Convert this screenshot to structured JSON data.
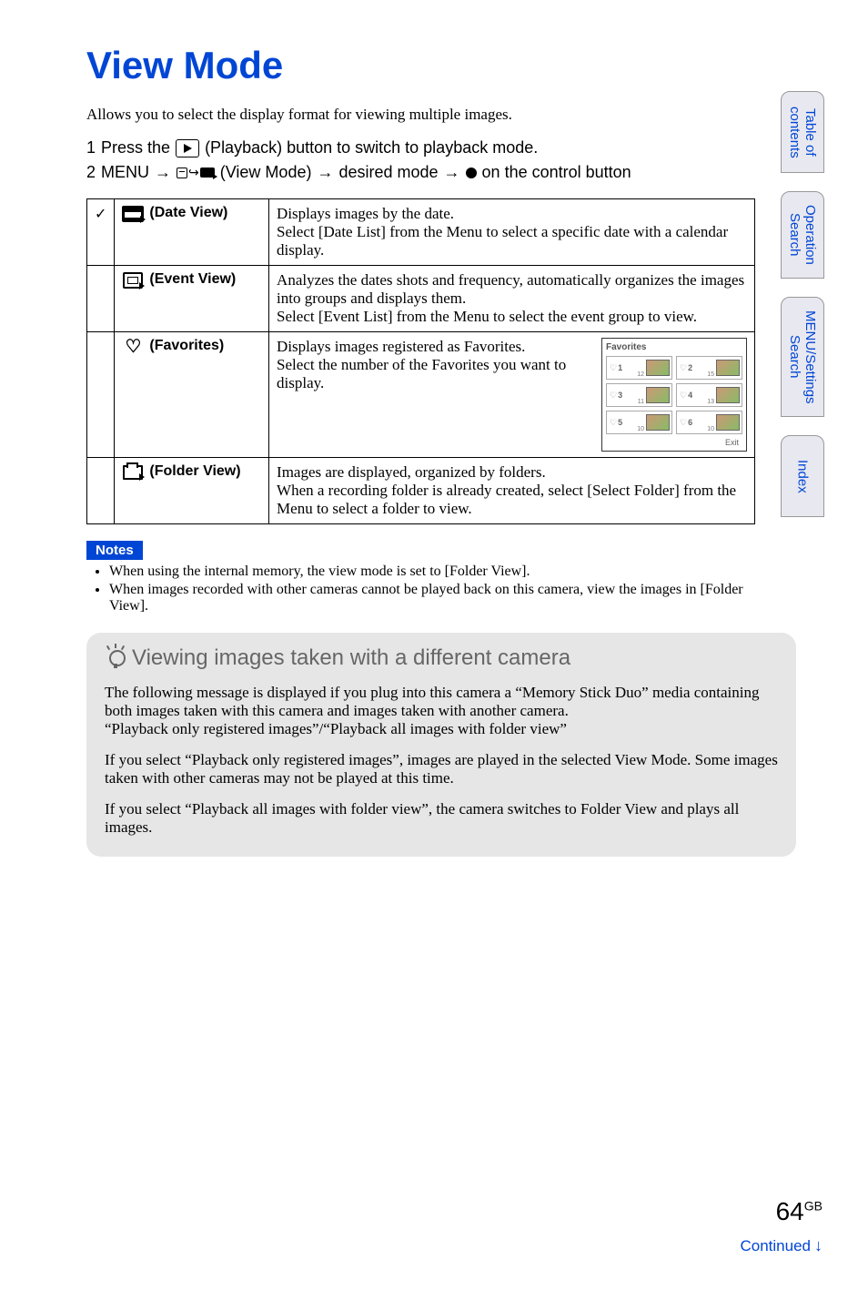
{
  "title": "View Mode",
  "intro": "Allows you to select the display format for viewing multiple images.",
  "steps": {
    "s1_num": "1",
    "s1_a": "Press the",
    "s1_b": "(Playback) button to switch to playback mode.",
    "s2_num": "2",
    "s2_a": "MENU",
    "s2_b": "(View Mode)",
    "s2_c": "desired mode",
    "s2_d": "on the control button"
  },
  "table": {
    "rows": [
      {
        "check": "✓",
        "label": "(Date View)",
        "desc": "Displays images by the date.\nSelect [Date List] from the Menu to select a specific date with a calendar display."
      },
      {
        "check": "",
        "label": "(Event View)",
        "desc": "Analyzes the dates shots and frequency, automatically organizes the images into groups and displays them.\nSelect [Event List] from the Menu to select the event group to view."
      },
      {
        "check": "",
        "label": "(Favorites)",
        "desc": "Displays images registered as Favorites.\nSelect the number of the Favorites you want to display."
      },
      {
        "check": "",
        "label": "(Folder View)",
        "desc": "Images are displayed, organized by folders.\nWhen a recording folder is already created, select [Select Folder] from the Menu to select a folder to view."
      }
    ]
  },
  "fav_preview": {
    "title": "Favorites",
    "cells": [
      {
        "n": "1",
        "c": "12"
      },
      {
        "n": "2",
        "c": "15"
      },
      {
        "n": "3",
        "c": "11"
      },
      {
        "n": "4",
        "c": "13"
      },
      {
        "n": "5",
        "c": "10"
      },
      {
        "n": "6",
        "c": "10"
      }
    ],
    "exit": "Exit"
  },
  "notes": {
    "badge": "Notes",
    "items": [
      "When using the internal memory, the view mode is set to [Folder View].",
      "When images recorded with other cameras cannot be played back on this camera, view the images in [Folder View]."
    ]
  },
  "tip": {
    "heading": "Viewing images taken with a different camera",
    "p1": "The following message is displayed if you plug into this camera a “Memory Stick Duo” media containing both images taken with this camera and images taken with another camera.",
    "p1b": "“Playback only registered images”/“Playback all images with folder view”",
    "p2": "If you select “Playback only registered images”, images are played in the selected View Mode. Some images taken with other cameras may not be played at this time.",
    "p3": "If you select “Playback all images with folder view”, the camera switches to Folder View and plays all images."
  },
  "side_tabs": [
    "Table of\ncontents",
    "Operation\nSearch",
    "MENU/Settings\nSearch",
    "Index"
  ],
  "footer": {
    "page": "64",
    "suffix": "GB",
    "continued": "Continued"
  }
}
